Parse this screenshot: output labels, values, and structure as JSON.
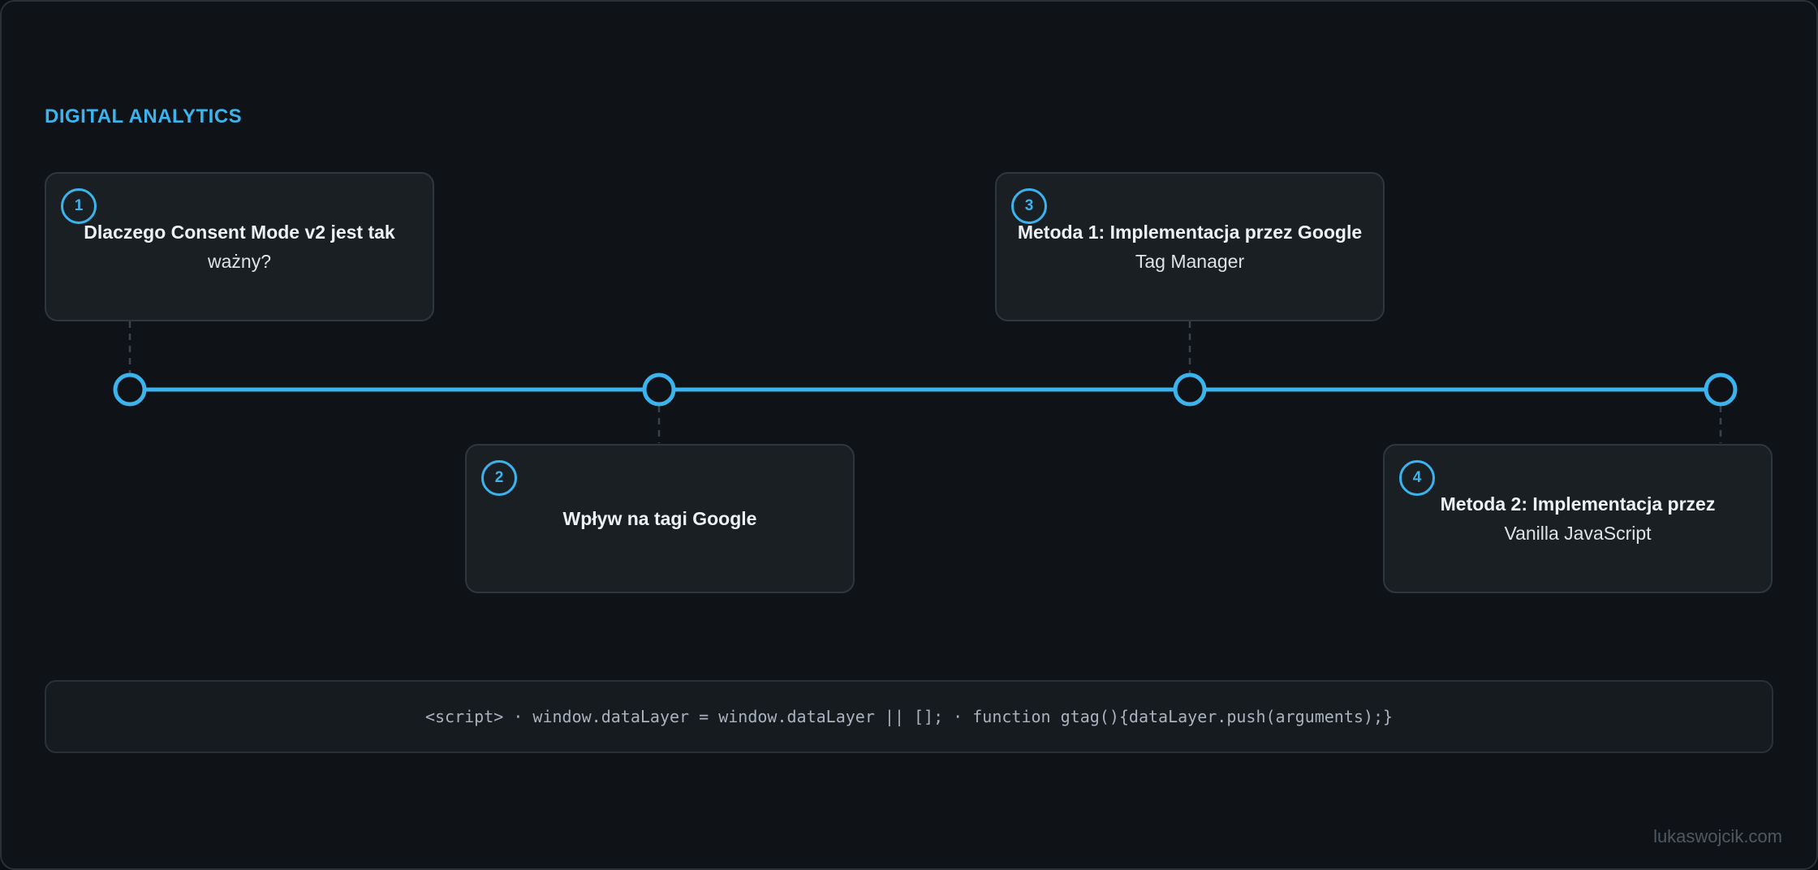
{
  "section_label": "DIGITAL ANALYTICS",
  "steps": [
    {
      "number": "1",
      "title": "Dlaczego Consent Mode v2 jest tak",
      "subtitle": "ważny?"
    },
    {
      "number": "2",
      "title": "Wpływ na tagi Google",
      "subtitle": ""
    },
    {
      "number": "3",
      "title": "Metoda 1: Implementacja przez Google",
      "subtitle": "Tag Manager"
    },
    {
      "number": "4",
      "title": "Metoda 2: Implementacja przez",
      "subtitle": "Vanilla JavaScript"
    }
  ],
  "code_snippet": "<script> · window.dataLayer = window.dataLayer || []; · function gtag(){dataLayer.push(arguments);}",
  "watermark": "lukaswojcik.com",
  "colors": {
    "accent": "#3bb4ee",
    "background": "#0f1317",
    "card": "#1a1f24"
  }
}
